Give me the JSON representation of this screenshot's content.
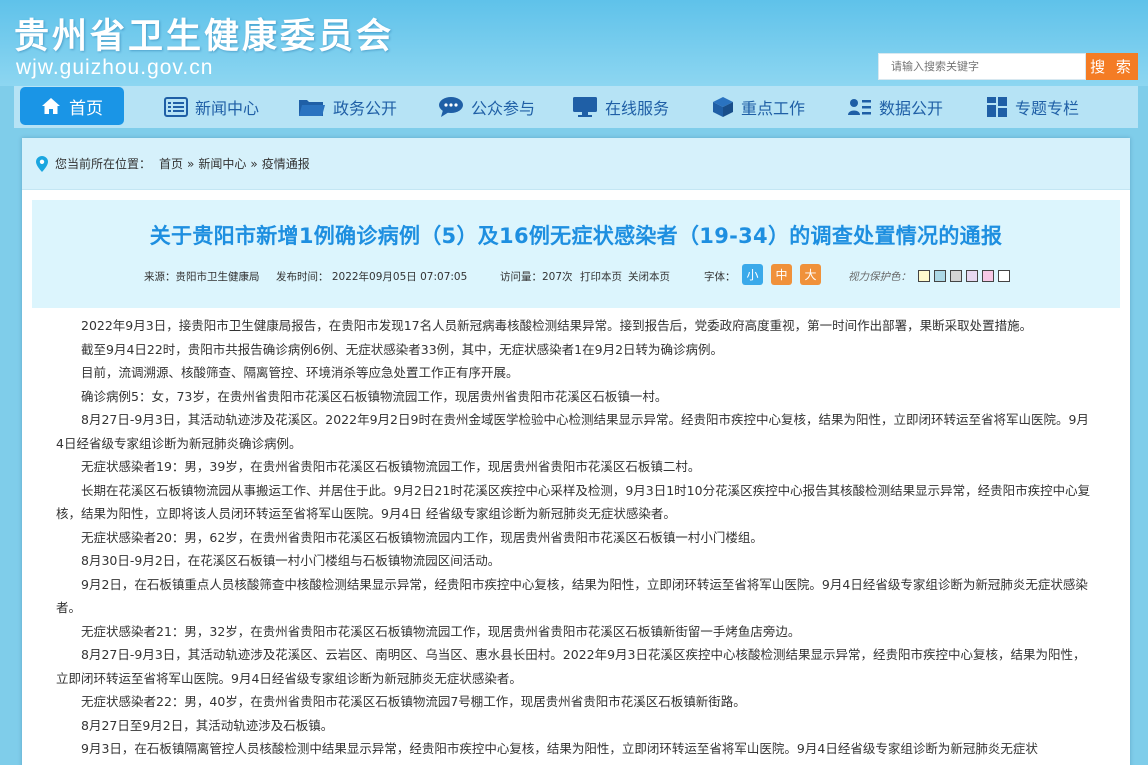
{
  "header": {
    "title": "贵州省卫生健康委员会",
    "domain": "wjw.guizhou.gov.cn",
    "search_placeholder": "请输入搜索关键字",
    "search_button": "搜 索"
  },
  "nav": {
    "home": "首页",
    "items": [
      "新闻中心",
      "政务公开",
      "公众参与",
      "在线服务",
      "重点工作",
      "数据公开",
      "专题专栏"
    ]
  },
  "breadcrumb": {
    "prefix": "您当前所在位置：",
    "items": [
      "首页",
      "新闻中心",
      "疫情通报"
    ],
    "separator": "»"
  },
  "article": {
    "title": "关于贵阳市新增1例确诊病例（5）及16例无症状感染者（19-34）的调查处置情况的通报",
    "source": "来源：贵阳市卫生健康局",
    "publish_time": "发布时间：  2022年09月05日 07:07:05",
    "views": "访问量：207次",
    "print": "打印本页",
    "close": "关闭本页",
    "font_label": "字体：",
    "font_sizes": [
      "小",
      "中",
      "大"
    ],
    "vision_label": "视力保护色：",
    "paragraphs": [
      "2022年9月3日，接贵阳市卫生健康局报告，在贵阳市发现17名人员新冠病毒核酸检测结果异常。接到报告后，党委政府高度重视，第一时间作出部署，果断采取处置措施。",
      "截至9月4日22时，贵阳市共报告确诊病例6例、无症状感染者33例，其中，无症状感染者1在9月2日转为确诊病例。",
      "目前，流调溯源、核酸筛查、隔离管控、环境消杀等应急处置工作正有序开展。",
      "确诊病例5：女，73岁，在贵州省贵阳市花溪区石板镇物流园工作，现居贵州省贵阳市花溪区石板镇一村。",
      "8月27日-9月3日，其活动轨迹涉及花溪区。2022年9月2日9时在贵州金域医学检验中心检测结果显示异常。经贵阳市疾控中心复核，结果为阳性，立即闭环转运至省将军山医院。9月4日经省级专家组诊断为新冠肺炎确诊病例。",
      "无症状感染者19：男，39岁，在贵州省贵阳市花溪区石板镇物流园工作，现居贵州省贵阳市花溪区石板镇二村。",
      "长期在花溪区石板镇物流园从事搬运工作、并居住于此。9月2日21时花溪区疾控中心采样及检测，9月3日1时10分花溪区疾控中心报告其核酸检测结果显示异常，经贵阳市疾控中心复核，结果为阳性，立即将该人员闭环转运至省将军山医院。9月4日  经省级专家组诊断为新冠肺炎无症状感染者。",
      "无症状感染者20：男，62岁，在贵州省贵阳市花溪区石板镇物流园内工作，现居贵州省贵阳市花溪区石板镇一村小门楼组。",
      "8月30日-9月2日，在花溪区石板镇一村小门楼组与石板镇物流园区间活动。",
      "9月2日，在石板镇重点人员核酸筛查中核酸检测结果显示异常，经贵阳市疾控中心复核，结果为阳性，立即闭环转运至省将军山医院。9月4日经省级专家组诊断为新冠肺炎无症状感染者。",
      "无症状感染者21：男，32岁，在贵州省贵阳市花溪区石板镇物流园工作，现居贵州省贵阳市花溪区石板镇新街留一手烤鱼店旁边。",
      "8月27日-9月3日，其活动轨迹涉及花溪区、云岩区、南明区、乌当区、惠水县长田村。2022年9月3日花溪区疾控中心核酸检测结果显示异常，经贵阳市疾控中心复核，结果为阳性，立即闭环转运至省将军山医院。9月4日经省级专家组诊断为新冠肺炎无症状感染者。",
      "无症状感染者22：男，40岁，在贵州省贵阳市花溪区石板镇物流园7号棚工作，现居贵州省贵阳市花溪区石板镇新街路。",
      "8月27日至9月2日，其活动轨迹涉及石板镇。",
      "9月3日，在石板镇隔离管控人员核酸检测中结果显示异常，经贵阳市疾控中心复核，结果为阳性，立即闭环转运至省将军山医院。9月4日经省级专家组诊断为新冠肺炎无症状"
    ]
  },
  "colors": {
    "header_bg": "#5fc2ea",
    "nav_bg": "#b6e3f5",
    "home_bg": "#1a95e6",
    "title_color": "#1e8fe0",
    "search_btn": "#f47c24",
    "font_small": "#3aa9ea",
    "font_medium": "#f0913a",
    "font_large": "#f0913a",
    "vision_swatches": [
      "#fffacd",
      "#add8e6",
      "#d3d3d3",
      "#e6d8f0",
      "#f7c9e6",
      "#ffffff"
    ]
  },
  "icons": {
    "home": "home-icon",
    "nav": [
      "news-icon",
      "folder-icon",
      "chat-icon",
      "monitor-icon",
      "cube-icon",
      "user-list-icon",
      "grid-icon"
    ],
    "location": "location-pin-icon"
  }
}
